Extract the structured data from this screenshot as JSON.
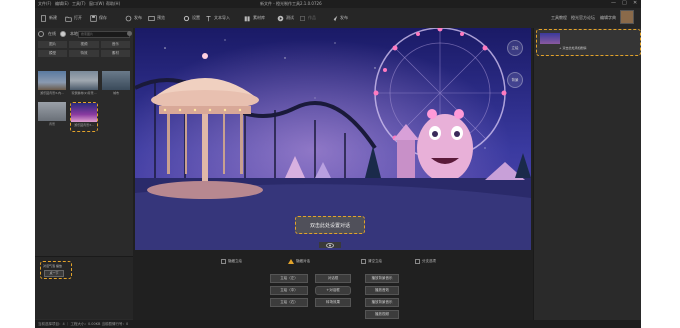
{
  "window": {
    "menu": [
      "文件(F)",
      "编辑(E)",
      "工具(T)",
      "窗口(W)",
      "帮助(H)"
    ],
    "title": "新文件 - 橙光制作工具2.1.0.0726",
    "controls": [
      "—",
      "□",
      "✕"
    ]
  },
  "toolbar": {
    "buttons": [
      {
        "label": "新建",
        "icon": "new-file-icon"
      },
      {
        "label": "打开",
        "icon": "open-folder-icon"
      },
      {
        "label": "保存",
        "icon": "save-icon"
      },
      {
        "label": "发布",
        "icon": "publish-icon"
      },
      {
        "label": "预览",
        "icon": "preview-icon"
      },
      {
        "label": "设置",
        "icon": "settings-icon"
      },
      {
        "label": "文本导入",
        "icon": "text-import-icon"
      },
      {
        "label": "素材库",
        "icon": "asset-library-icon"
      },
      {
        "label": "测试",
        "icon": "test-play-icon"
      },
      {
        "label": "作品",
        "icon": "works-icon"
      },
      {
        "label": "发布",
        "icon": "send-icon"
      }
    ],
    "right_links": [
      "工具教程",
      "橙光官方论坛",
      "编辑字典"
    ]
  },
  "left_panel": {
    "radio_options": [
      "在线",
      "本地"
    ],
    "search_placeholder": "搜索图片",
    "categories": [
      "图片",
      "视频",
      "音乐",
      "模型",
      "特效",
      "素材"
    ],
    "thumbnails": [
      {
        "caption": "游乐园背景3-内..."
      },
      {
        "caption": "玩偶素材(2)背景..."
      },
      {
        "caption": "城市"
      },
      {
        "caption": "背景"
      },
      {
        "caption": "游乐园背景3..."
      }
    ],
    "bottom_chip_label": "对话气泡 播放",
    "bottom_chip_button": "点一下"
  },
  "canvas": {
    "dialog_text": "双击此处设置对话",
    "side_buttons": [
      "立绘",
      "背景"
    ]
  },
  "options_row": [
    {
      "label": "隐藏立绘",
      "type": "checkbox"
    },
    {
      "label": "隐藏对话",
      "type": "warning"
    },
    {
      "label": "清空立绘",
      "type": "checkbox"
    },
    {
      "label": "分支选项",
      "type": "checkbox"
    }
  ],
  "command_buttons": {
    "col1": [
      "立绘（左）",
      "立绘（中）",
      "立绘（右）"
    ],
    "col2": [
      "对话框",
      "+对话框",
      "转场效果"
    ],
    "col3": [
      "播放背景音乐",
      "播放音效",
      "播放背景音乐",
      "播放视频"
    ]
  },
  "right_panel": {
    "slide_label": "+ 双击此处添加剧情"
  },
  "statusbar": {
    "text": "当前选择项目：4 ｜ 工程大小：0.00KB 当前剧情行号：0"
  }
}
